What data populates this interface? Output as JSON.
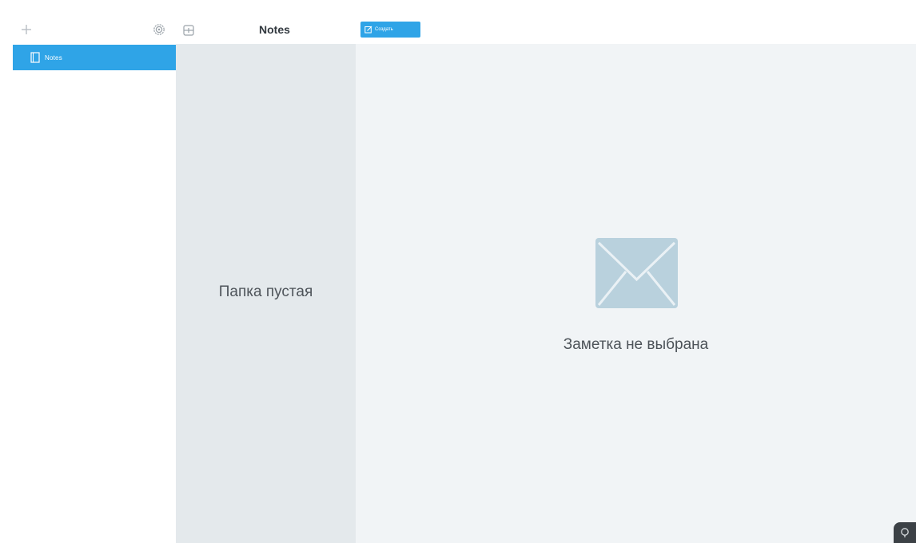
{
  "sidebar": {
    "add_folder_icon": "plus-icon",
    "settings_icon": "gear-icon",
    "folders": [
      {
        "label": "Notes",
        "icon": "folder-icon",
        "selected": true
      }
    ]
  },
  "notes_list": {
    "collapse_icon": "collapse-panel-icon",
    "title": "Notes",
    "empty_text": "Папка пустая"
  },
  "toolbar": {
    "create_label": "Создать",
    "create_icon": "edit-icon"
  },
  "editor": {
    "empty_icon": "envelope-icon",
    "empty_text": "Заметка не выбрана"
  },
  "help": {
    "icon": "help-icon"
  },
  "colors": {
    "accent": "#2fa4e7",
    "notes_list_bg": "#e4e9ec",
    "editor_bg": "#f1f4f6",
    "envelope": "#b9d1dd"
  }
}
